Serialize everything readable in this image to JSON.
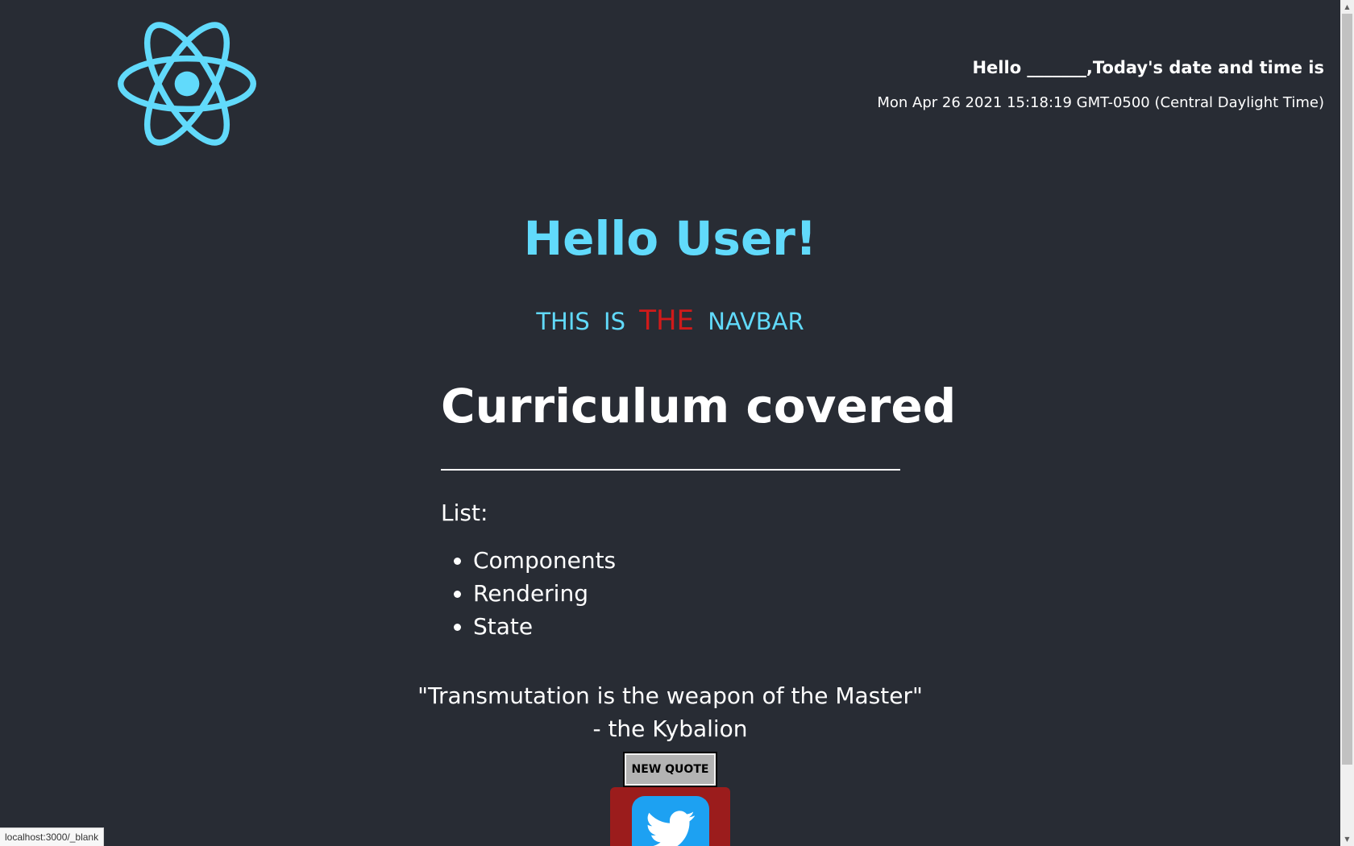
{
  "header": {
    "logo_icon": "react-logo-icon",
    "greeting_line": "Hello _______,Today's date and time is",
    "datetime": "Mon Apr 26 2021 15:18:19 GMT-0500 (Central Daylight Time)"
  },
  "main": {
    "title": "Hello User!",
    "navbar": {
      "items": [
        "THIS",
        "IS",
        "THE",
        "NAVBAR"
      ],
      "highlight_color": "#d01a1a"
    },
    "curriculum": {
      "heading": "Curriculum covered",
      "list_label": "List:",
      "items": [
        "Components",
        "Rendering",
        "State"
      ]
    },
    "quote": {
      "text": "\"Transmutation is the weapon of the Master\"",
      "author": "- the Kybalion"
    },
    "new_quote_button": "NEW QUOTE",
    "tweet_icon": "twitter-bird-icon"
  },
  "status_bar": {
    "link": "localhost:3000/_blank"
  },
  "colors": {
    "background": "#282c34",
    "accent": "#61dafb",
    "tweet_box": "#9b1c1c",
    "twitter_blue": "#1da1f2"
  }
}
